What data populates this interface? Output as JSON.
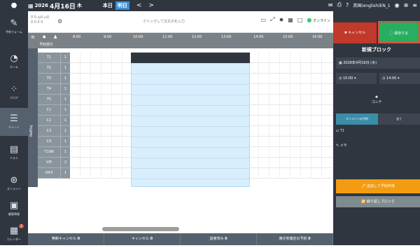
{
  "topbar": {
    "date_year": "2026",
    "date_main": "4月16日",
    "weekday": "木",
    "today_label": "本日",
    "tomorrow_label": "明日",
    "prev_icon": "chevron-left-icon",
    "next_icon": "chevron-right-icon",
    "user_label": "英国(english)EN_1"
  },
  "sidebar": [
    {
      "label": "予約フォーム",
      "icon": "edit-icon"
    },
    {
      "label": "ホーム",
      "icon": "home-icon"
    },
    {
      "label": "フロア",
      "icon": "floor-icon"
    },
    {
      "label": "チャート",
      "icon": "chart-icon"
    },
    {
      "label": "リスト",
      "icon": "list-icon"
    },
    {
      "label": "オンライン",
      "icon": "online-icon"
    },
    {
      "label": "顧客情報",
      "icon": "customer-icon"
    },
    {
      "label": "カレンダー",
      "icon": "calendar-icon",
      "badge": "2"
    }
  ],
  "counts": {
    "line1": "0 0 ◎0 ⛀0",
    "line2": "0 0   0   0"
  },
  "search": {
    "placeholder": "クリックして注文ボを入力"
  },
  "online_label": "オンライン",
  "grid": {
    "unassigned_label": "予約部分",
    "section_label": "ReBSq",
    "time_headers": [
      "8:00",
      "9:00",
      "10:00",
      "11:00",
      "12:00",
      "13:00",
      "14:00",
      "15:00",
      "16:00"
    ],
    "rows": [
      {
        "name": "T1",
        "count": "1"
      },
      {
        "name": "T2",
        "count": "1"
      },
      {
        "name": "T3",
        "count": "1"
      },
      {
        "name": "T4",
        "count": "1"
      },
      {
        "name": "T5",
        "count": "1"
      },
      {
        "name": "C1",
        "count": "1"
      },
      {
        "name": "C2",
        "count": "1"
      },
      {
        "name": "C3",
        "count": "1"
      },
      {
        "name": "C4",
        "count": "1"
      },
      {
        "name": "T10N",
        "count": "1"
      },
      {
        "name": "VIP",
        "count": "2"
      },
      {
        "name": "VIP3",
        "count": "1"
      }
    ]
  },
  "footer": [
    {
      "label": "無断キャンセル",
      "count": "0"
    },
    {
      "label": "キャンセル",
      "count": "0"
    },
    {
      "label": "退席済み",
      "count": "0"
    },
    {
      "label": "席が未確定の予約",
      "count": "0"
    }
  ],
  "panel": {
    "cancel_label": "✖ キャンセル",
    "save_label": "◯ 保存する",
    "title": "新規ブロック",
    "date_value": "2026年4月16日 (木)",
    "start_time": "10:00",
    "end_time": "14:00",
    "course_label": "コンテ",
    "tab_online": "オンラインの予約",
    "tab_all": "全て",
    "table_value": "T1",
    "memo_label": "メモ",
    "add_button": "🖊 追加して予約作成",
    "repeat_button": "🔁 繰り返しブロック"
  },
  "colors": {
    "dark": "#2f3640",
    "accent_blue": "#3b8ed8",
    "save_green": "#27ae60",
    "cancel_red": "#c0392b",
    "orange": "#f39c12",
    "block_light": "#d8eefc"
  }
}
